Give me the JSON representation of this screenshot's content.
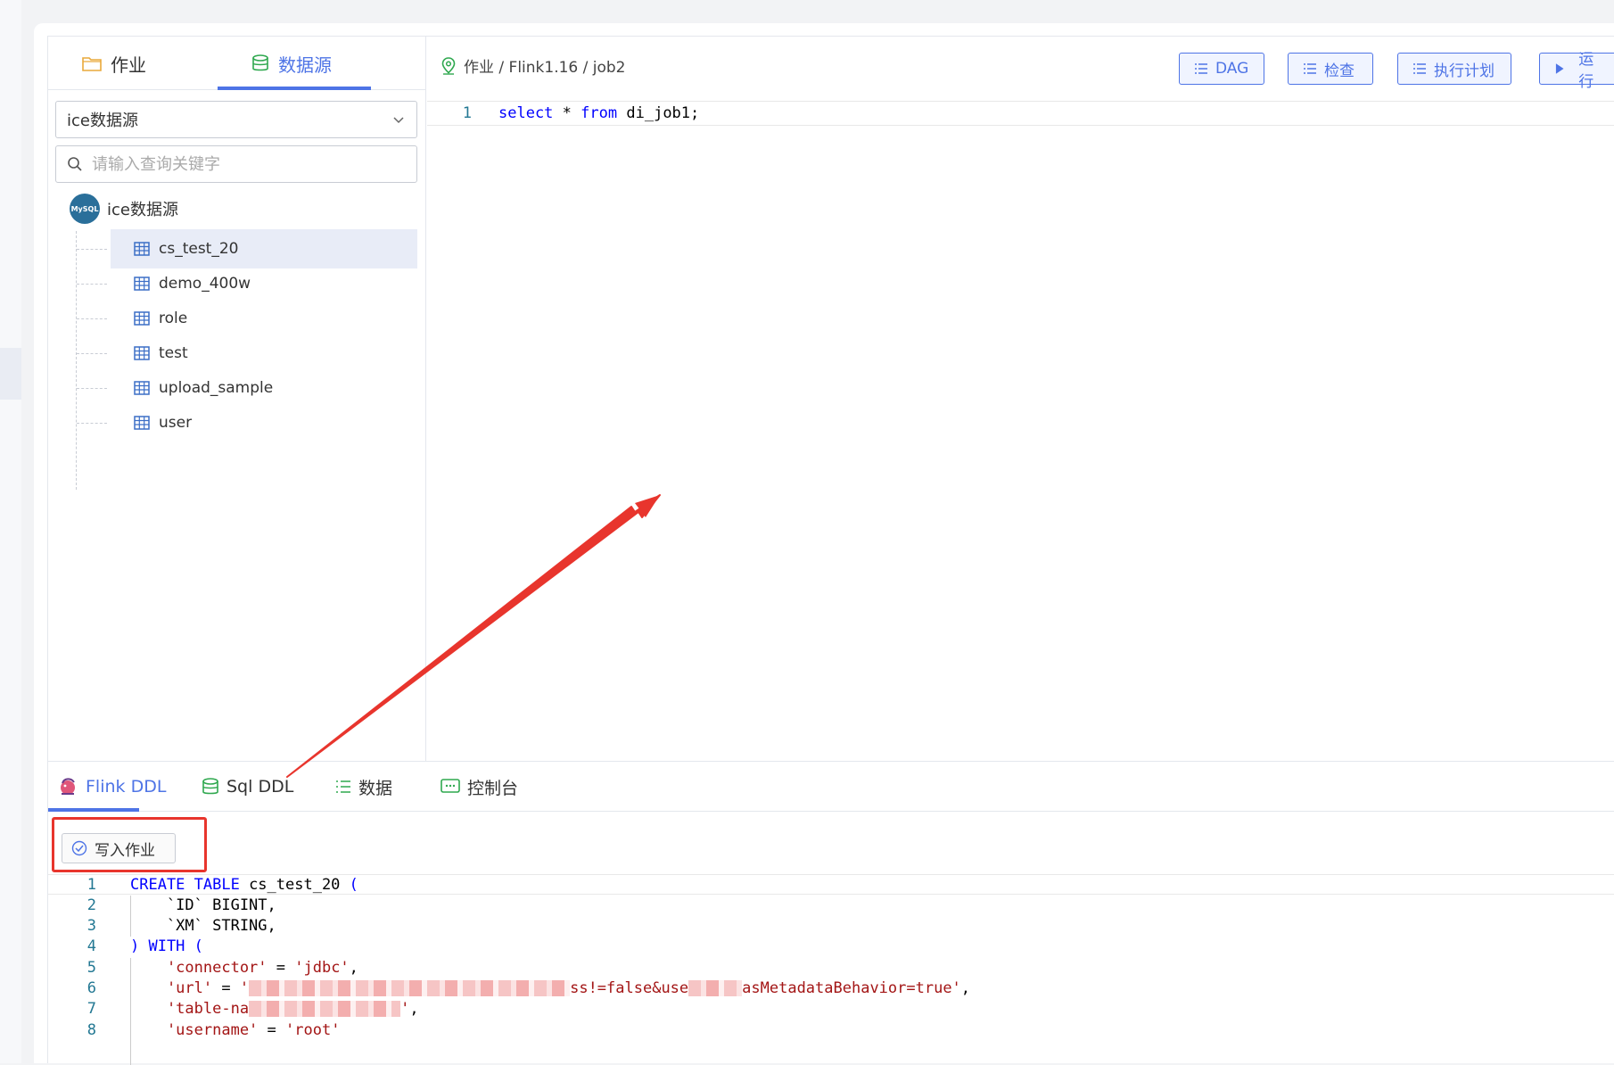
{
  "sidebar": {
    "tabs": [
      {
        "label": "作业",
        "icon": "folder-icon"
      },
      {
        "label": "数据源",
        "icon": "database-icon"
      }
    ],
    "datasource_select": {
      "value": "ice数据源"
    },
    "search": {
      "placeholder": "请输入查询关键字"
    },
    "tree": {
      "root": {
        "label": "ice数据源",
        "logo_text": "MySQL"
      },
      "items": [
        {
          "label": "cs_test_20",
          "selected": true
        },
        {
          "label": "demo_400w",
          "selected": false
        },
        {
          "label": "role",
          "selected": false
        },
        {
          "label": "test",
          "selected": false
        },
        {
          "label": "upload_sample",
          "selected": false
        },
        {
          "label": "user",
          "selected": false
        }
      ]
    }
  },
  "header": {
    "breadcrumb": "作业 / Flink1.16 / job2",
    "buttons": {
      "dag": "DAG",
      "check": "检查",
      "plan": "执行计划",
      "run": "运行"
    }
  },
  "editor": {
    "line_number": "1",
    "tokens": {
      "select": "select",
      "star": "*",
      "from": "from",
      "rest": "di_job1;"
    }
  },
  "bottom": {
    "tabs": [
      {
        "label": "Flink DDL"
      },
      {
        "label": "Sql DDL"
      },
      {
        "label": "数据"
      },
      {
        "label": "控制台"
      }
    ],
    "write_button": "写入作业",
    "ddl_lines": [
      {
        "n": "1",
        "parts": [
          [
            "kw",
            "CREATE TABLE"
          ],
          [
            "id",
            " cs_test_20 "
          ],
          [
            "kw",
            "("
          ]
        ]
      },
      {
        "n": "2",
        "parts": [
          [
            "id",
            "    `ID` BIGINT,"
          ]
        ]
      },
      {
        "n": "3",
        "parts": [
          [
            "id",
            "    `XM` STRING,"
          ]
        ]
      },
      {
        "n": "4",
        "parts": [
          [
            "kw",
            ") WITH ("
          ]
        ]
      },
      {
        "n": "5",
        "parts": [
          [
            "str",
            "    'connector'"
          ],
          [
            "id",
            " = "
          ],
          [
            "str",
            "'jdbc'"
          ],
          [
            "id",
            ","
          ]
        ]
      },
      {
        "n": "6",
        "parts": [
          [
            "str",
            "    'url'"
          ],
          [
            "id",
            " = "
          ],
          [
            "str",
            "'"
          ],
          [
            "blur",
            "360"
          ],
          [
            "str",
            "ss!=false&use"
          ],
          [
            "blur",
            "60"
          ],
          [
            "str",
            "asMetadataBehavior=true'"
          ],
          [
            "id",
            ","
          ]
        ]
      },
      {
        "n": "7",
        "parts": [
          [
            "str",
            "    'table-na"
          ],
          [
            "blur",
            "170"
          ],
          [
            "str",
            "'"
          ],
          [
            "id",
            ","
          ]
        ]
      },
      {
        "n": "8",
        "parts": [
          [
            "str",
            "    'username'"
          ],
          [
            "id",
            " = "
          ],
          [
            "str",
            "'root'"
          ]
        ]
      }
    ]
  },
  "colors": {
    "accent": "#4e74e6",
    "annotation": "#e8352d",
    "keyword": "#0000ff",
    "string": "#a31515",
    "line_number": "#237893"
  }
}
